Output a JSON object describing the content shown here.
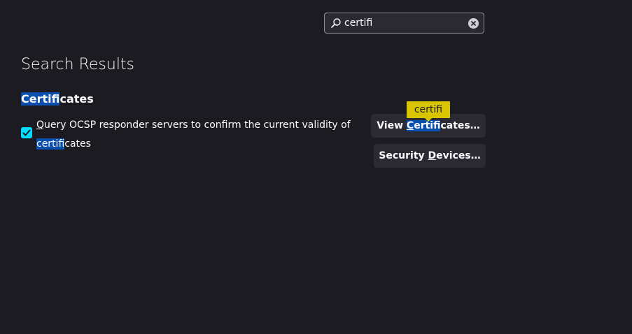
{
  "search": {
    "value": "certifi",
    "icons": {
      "search": "search-icon",
      "clear": "clear-icon"
    }
  },
  "results": {
    "title": "Search Results"
  },
  "certificates": {
    "group_title_highlight": "Certifi",
    "group_title_rest": "cates",
    "ocsp": {
      "checked": true,
      "label_accesskey": "Q",
      "label_line1_rest": "uery OCSP responder servers to confirm the current validity of",
      "label_line2_highlight": "certifi",
      "label_line2_rest": "cates"
    },
    "view_button": {
      "before": "View ",
      "accesskey": "C",
      "highlight_rest": "ertifi",
      "after": "cates…"
    },
    "devices_button": {
      "before": "Security ",
      "accesskey": "D",
      "after": "evices…"
    },
    "tooltip": "certifi"
  },
  "colors": {
    "background": "#1c1b22",
    "highlight": "#0b4fae",
    "checkbox": "#00ddff",
    "tooltip": "#d9c400",
    "button": "#2b2a33"
  }
}
